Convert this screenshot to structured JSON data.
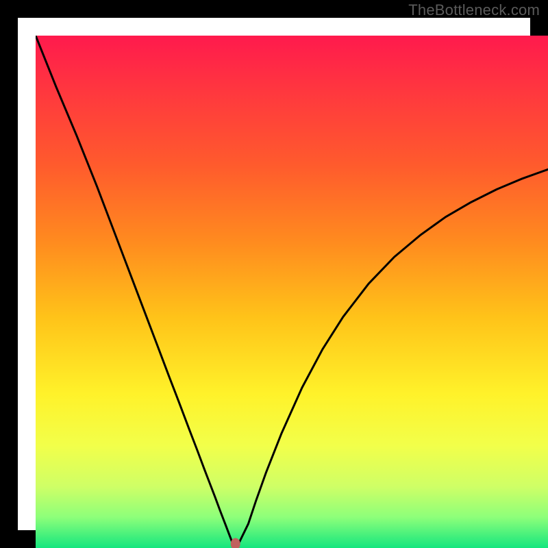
{
  "watermark": "TheBottleneck.com",
  "chart_data": {
    "type": "line",
    "title": "",
    "xlabel": "",
    "ylabel": "",
    "xlim": [
      0,
      100
    ],
    "ylim": [
      0,
      100
    ],
    "legend": false,
    "grid": false,
    "background": "rainbow-vertical-red-to-green",
    "series": [
      {
        "name": "bottleneck-curve",
        "x": [
          0,
          4,
          8,
          12,
          15,
          18,
          21,
          24,
          26,
          28,
          30,
          31.5,
          33,
          34,
          35,
          36,
          37,
          37.8,
          38.4,
          38.8,
          39.2,
          41.5,
          43,
          45,
          48,
          52,
          56,
          60,
          65,
          70,
          75,
          80,
          85,
          90,
          95,
          100
        ],
        "y": [
          100,
          90,
          80.5,
          70.5,
          62.6,
          54.7,
          46.8,
          38.9,
          33.6,
          28.4,
          23.1,
          19.2,
          15.2,
          12.6,
          10.0,
          7.3,
          4.7,
          2.6,
          1.05,
          0.0,
          0.0,
          4.7,
          9.2,
          14.8,
          22.4,
          31.3,
          38.8,
          45.1,
          51.6,
          56.8,
          61.0,
          64.6,
          67.5,
          70.0,
          72.1,
          73.9
        ]
      }
    ],
    "marker": {
      "x": 39.0,
      "y": 0.0,
      "color": "#c0625e"
    },
    "gradient_stops": [
      {
        "offset": 0.0,
        "color": "#ff1a4d"
      },
      {
        "offset": 0.12,
        "color": "#ff3a3d"
      },
      {
        "offset": 0.25,
        "color": "#ff5a2d"
      },
      {
        "offset": 0.4,
        "color": "#ff8a1f"
      },
      {
        "offset": 0.55,
        "color": "#ffc319"
      },
      {
        "offset": 0.7,
        "color": "#fff22a"
      },
      {
        "offset": 0.8,
        "color": "#f2ff4a"
      },
      {
        "offset": 0.88,
        "color": "#cfff66"
      },
      {
        "offset": 0.94,
        "color": "#8dff7a"
      },
      {
        "offset": 1.0,
        "color": "#14e67e"
      }
    ]
  }
}
